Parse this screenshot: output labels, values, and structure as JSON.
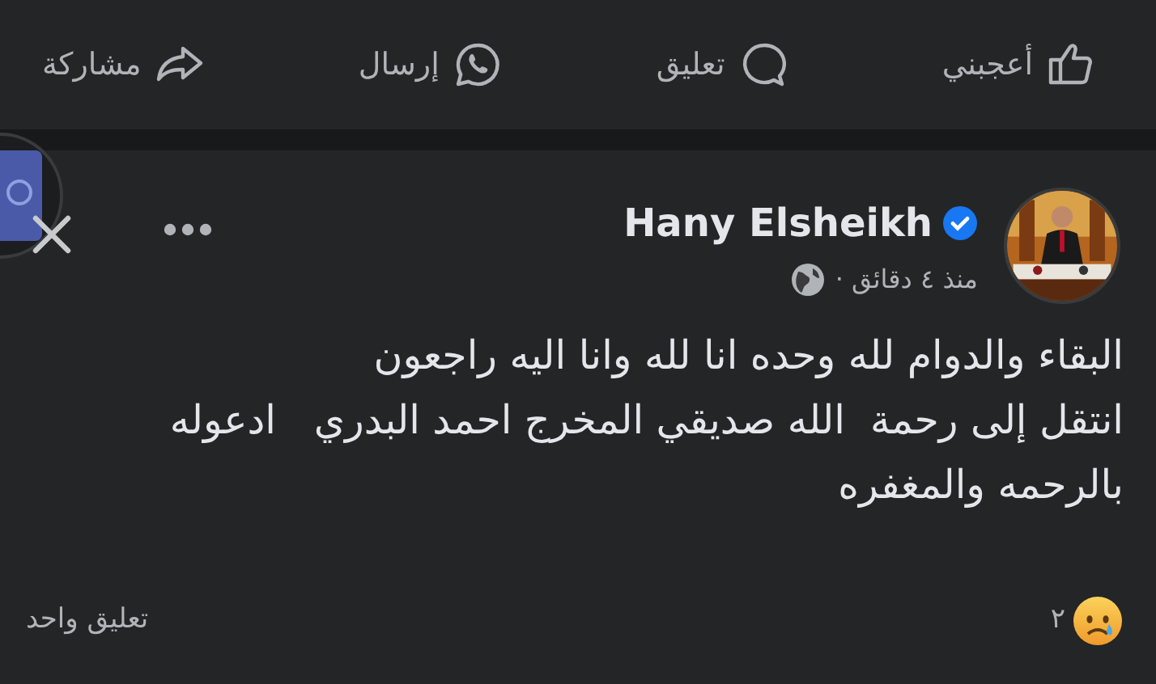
{
  "action_bar": [
    {
      "kind": "like",
      "label": "أعجبني"
    },
    {
      "kind": "comment",
      "label": "تعليق"
    },
    {
      "kind": "send",
      "label": "إرسال"
    },
    {
      "kind": "share",
      "label": "مشاركة"
    }
  ],
  "post": {
    "author": "Hany Elsheikh",
    "verified": true,
    "time": "منذ ٤ دقائق ·",
    "paragraphs": [
      "البقاء والدوام لله وحده انا لله وانا اليه راجعون",
      "انتقل إلى رحمة  الله صديقي المخرج احمد البدري   ادعوله بالرحمه والمغفره"
    ],
    "reaction_count": "٢",
    "comment_count": "تعليق واحد"
  }
}
